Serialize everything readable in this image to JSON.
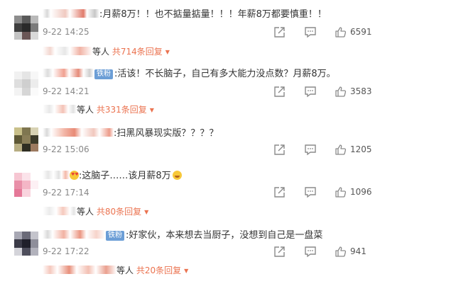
{
  "comments": [
    {
      "text": ":月薪8万！！也不掂量掂量！！！年薪8万都要慎重！！",
      "time": "9-22 14:25",
      "likes": "6591",
      "reply_prefix": "等人 ",
      "reply_count": "共714条回复",
      "badge": ""
    },
    {
      "text": ":活该！不长脑子，自己有多大能力没点数？月薪8万。",
      "time": "9-22 14:21",
      "likes": "3583",
      "reply_prefix": "等人 ",
      "reply_count": "共331条回复",
      "badge": "铁粉"
    },
    {
      "text": ":扫黑风暴现实版？？？？",
      "time": "9-22 15:06",
      "likes": "1205",
      "reply_prefix": "",
      "reply_count": "",
      "badge": ""
    },
    {
      "text": ":这脑子……该月薪8万",
      "time": "9-22 17:14",
      "likes": "1096",
      "reply_prefix": "等人 ",
      "reply_count": "共80条回复",
      "badge": ""
    },
    {
      "text": ":好家伙，本来想去当厨子，没想到自己是一盘菜",
      "time": "9-22 17:22",
      "likes": "941",
      "reply_prefix": "等人 ",
      "reply_count": "共20条回复",
      "badge": "铁粉"
    }
  ],
  "icons": {
    "share": "share-icon",
    "comment": "comment-icon",
    "like": "thumbs-up-icon",
    "expand": "chevron-down-icon",
    "badge": "fan-badge-icon"
  },
  "colors": {
    "accent": "#eb7350",
    "badge": "#6c9ed6",
    "muted": "#888888"
  }
}
